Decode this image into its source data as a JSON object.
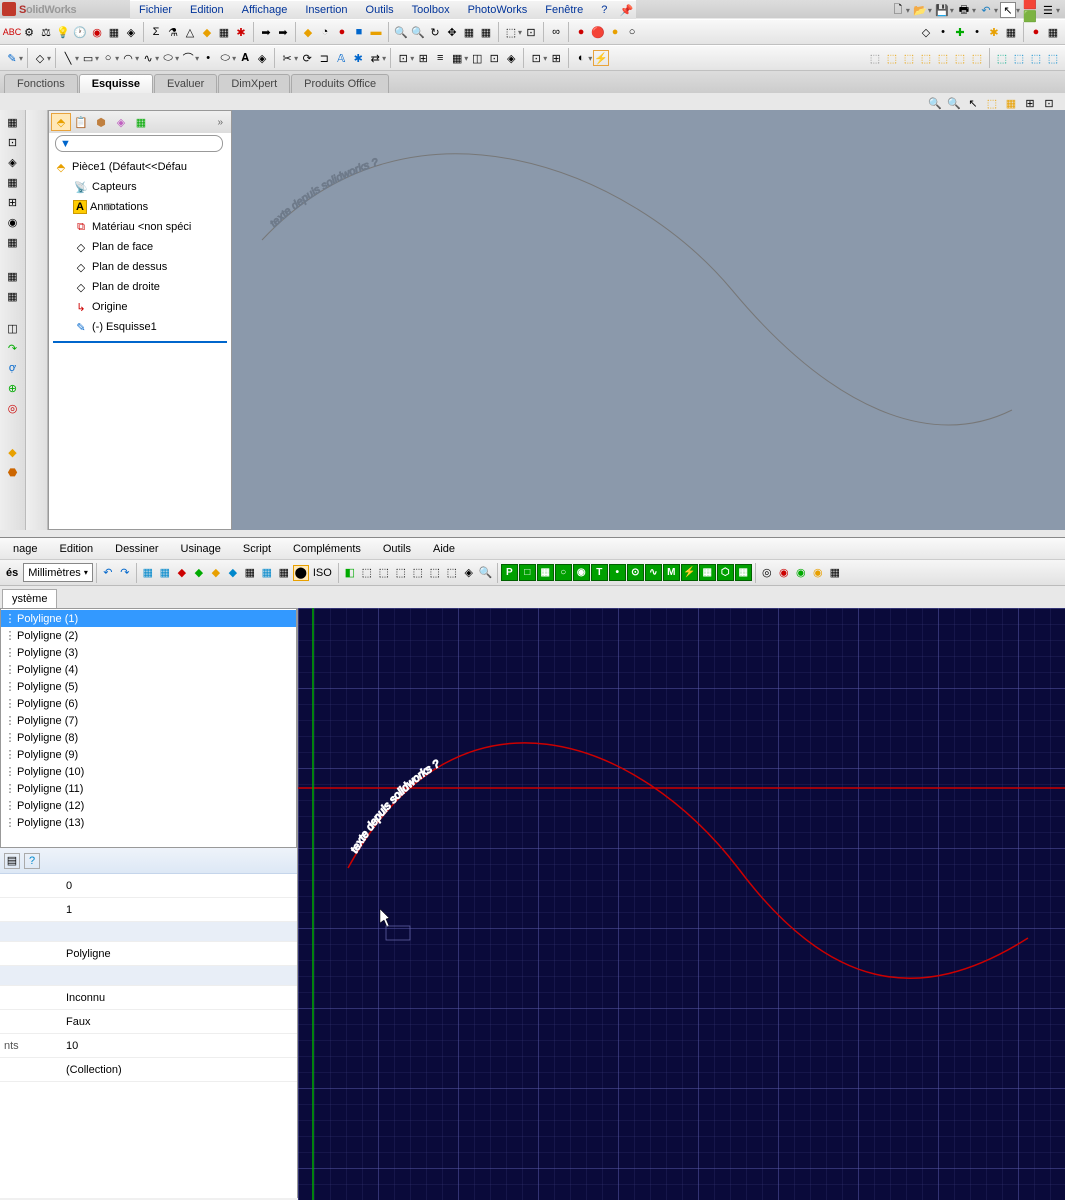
{
  "solidworks": {
    "title_prefix": "S",
    "title_rest": "olidWorks",
    "menu": [
      "Fichier",
      "Edition",
      "Affichage",
      "Insertion",
      "Outils",
      "Toolbox",
      "PhotoWorks",
      "Fenêtre",
      "?"
    ],
    "tabs": [
      "Fonctions",
      "Esquisse",
      "Evaluer",
      "DimXpert",
      "Produits Office"
    ],
    "active_tab": "Esquisse",
    "tree": {
      "root": "Pièce1  (Défaut<<Défau",
      "items": [
        {
          "icon": "📡",
          "label": "Capteurs"
        },
        {
          "icon": "A",
          "label": "Annotations",
          "expandable": true
        },
        {
          "icon": "⧉",
          "label": "Matériau <non spéci",
          "color": "#d00"
        },
        {
          "icon": "◇",
          "label": "Plan de face"
        },
        {
          "icon": "◇",
          "label": "Plan de dessus"
        },
        {
          "icon": "◇",
          "label": "Plan de droite"
        },
        {
          "icon": "↳",
          "label": "Origine",
          "color": "#c00"
        },
        {
          "icon": "✎",
          "label": "(-) Esquisse1",
          "color": "#0066cc"
        }
      ]
    },
    "canvas_text": "texte depuis solidworks ?"
  },
  "cambam": {
    "menu": [
      "nage",
      "Edition",
      "Dessiner",
      "Usinage",
      "Script",
      "Compléments",
      "Outils",
      "Aide"
    ],
    "unit_combo_label": "és",
    "unit_combo_value": "Millimètres",
    "iso_label": "ISO",
    "tab": "ystème",
    "list_items": [
      "Polyligne (1)",
      "Polyligne (2)",
      "Polyligne (3)",
      "Polyligne (4)",
      "Polyligne (5)",
      "Polyligne (6)",
      "Polyligne (7)",
      "Polyligne (8)",
      "Polyligne (9)",
      "Polyligne (10)",
      "Polyligne (11)",
      "Polyligne (12)",
      "Polyligne (13)"
    ],
    "selected_item": "Polyligne (1)",
    "props": [
      {
        "k": "",
        "v": "0"
      },
      {
        "k": "",
        "v": "1"
      },
      {
        "k": "",
        "v": ""
      },
      {
        "k": "",
        "v": "Polyligne"
      },
      {
        "k": "",
        "v": ""
      },
      {
        "k": "",
        "v": "Inconnu"
      },
      {
        "k": "",
        "v": "Faux"
      },
      {
        "k": "nts",
        "v": "10"
      },
      {
        "k": "",
        "v": "(Collection)"
      }
    ],
    "canvas_text": "texte depuis solidworks ?"
  }
}
